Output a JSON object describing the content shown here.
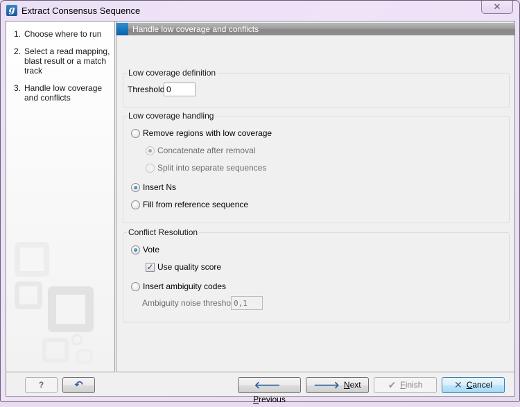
{
  "window": {
    "title": "Extract Consensus Sequence",
    "app_icon": "g-icon",
    "close_label": "✕"
  },
  "steps": [
    {
      "num": "1.",
      "label": "Choose where to run"
    },
    {
      "num": "2.",
      "label": "Select a read mapping, blast result or a match track"
    },
    {
      "num": "3.",
      "label": "Handle low coverage and conflicts"
    }
  ],
  "header": {
    "title": "Handle low coverage and conflicts"
  },
  "low_coverage_definition": {
    "legend": "Low coverage definition",
    "threshold_label": "Threshold",
    "threshold_value": "0"
  },
  "low_coverage_handling": {
    "legend": "Low coverage handling",
    "options": [
      {
        "label": "Remove regions with low coverage",
        "checked": false,
        "enabled": true
      },
      {
        "label": "Concatenate after removal",
        "checked": true,
        "enabled": false
      },
      {
        "label": "Split into separate sequences",
        "checked": false,
        "enabled": false
      },
      {
        "label": "Insert Ns",
        "checked": true,
        "enabled": true
      },
      {
        "label": "Fill from reference sequence",
        "checked": false,
        "enabled": true
      }
    ]
  },
  "conflict_resolution": {
    "legend": "Conflict Resolution",
    "vote_label": "Vote",
    "vote_checked": true,
    "use_quality_label": "Use quality score",
    "use_quality_checked": true,
    "ambiguity_label": "Insert ambiguity codes",
    "ambiguity_checked": false,
    "noise_threshold_label": "Ambiguity noise threshold",
    "noise_threshold_value": "0,1"
  },
  "footer": {
    "help_label": "?",
    "reset_icon": "undo-arrow-icon",
    "previous_mnemonic": "P",
    "previous_rest": "revious",
    "next_mnemonic": "N",
    "next_rest": "ext",
    "finish_mnemonic": "F",
    "finish_rest": "inish",
    "cancel_mnemonic": "C",
    "cancel_rest": "ancel"
  }
}
